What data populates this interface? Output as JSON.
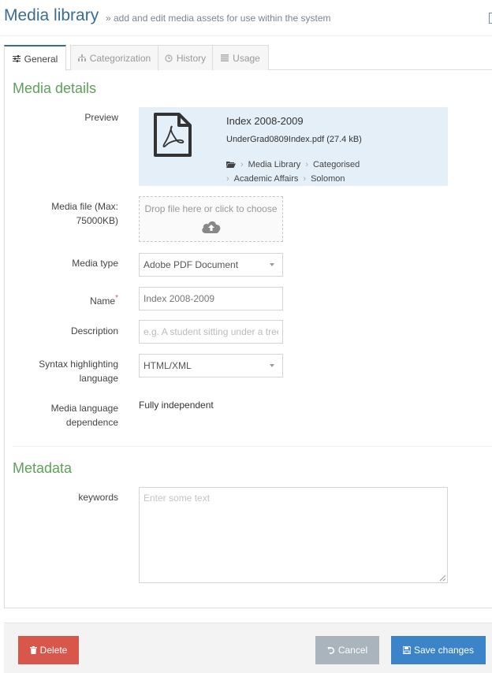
{
  "header": {
    "title": "Media library",
    "subtitle": "» add and edit media assets for use within the system"
  },
  "tabs": [
    {
      "label": "General",
      "icon": "sliders-icon",
      "active": true
    },
    {
      "label": "Categorization",
      "icon": "sitemap-icon",
      "active": false
    },
    {
      "label": "History",
      "icon": "clock-icon",
      "active": false
    },
    {
      "label": "Usage",
      "icon": "list-icon",
      "active": false
    }
  ],
  "media_details": {
    "section_title": "Media details",
    "preview": {
      "label": "Preview",
      "title": "Index 2008-2009",
      "file": "UnderGrad0809Index.pdf (27.4 kB)",
      "path": [
        "Media Library",
        "Categorised",
        "Academic Affairs",
        "Solomon"
      ]
    },
    "media_file": {
      "label": "Media file (Max: 75000KB)",
      "dropzone_text": "Drop file here or click to choose"
    },
    "media_type": {
      "label": "Media type",
      "value": "Adobe PDF Document"
    },
    "name": {
      "label": "Name",
      "required_mark": "*",
      "value": "Index 2008-2009"
    },
    "description": {
      "label": "Description",
      "placeholder": "e.g. A student sitting under a tree"
    },
    "syntax": {
      "label": "Syntax highlighting language",
      "value": "HTML/XML"
    },
    "language_dependence": {
      "label": "Media language dependence",
      "value": "Fully independent"
    }
  },
  "metadata": {
    "section_title": "Metadata",
    "keywords": {
      "label": "keywords",
      "placeholder": "Enter some text"
    }
  },
  "footer": {
    "delete_label": "Delete",
    "cancel_label": "Cancel",
    "save_label": "Save changes"
  },
  "colors": {
    "title": "#3a6d93",
    "section": "#5fa05a",
    "delete": "#d9574a",
    "cancel": "#aab4bd",
    "save": "#3b84c9",
    "preview_bg": "#e4eff7"
  }
}
